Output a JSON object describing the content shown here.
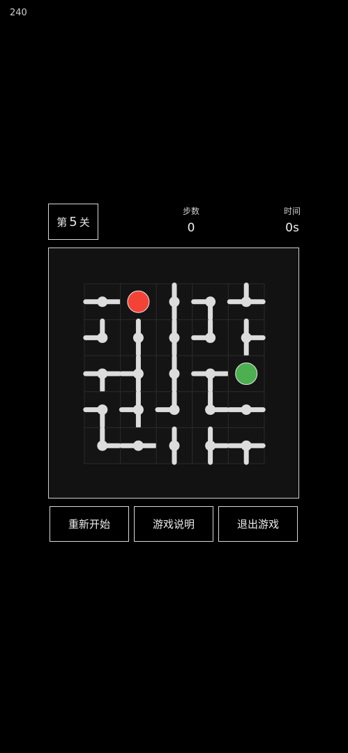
{
  "status": {
    "counter": "240"
  },
  "level": {
    "prefix": "第",
    "number": "5",
    "suffix": "关"
  },
  "stats": {
    "steps_label": "步数",
    "steps_value": "0",
    "time_label": "时间",
    "time_value": "0s"
  },
  "board": {
    "rows": 5,
    "cols": 5,
    "pipe_color": "#dcdcdc",
    "grid_color": "#2a2a2a",
    "cells": [
      [
        {
          "type": "pipe",
          "dirs": [
            "W",
            "E"
          ]
        },
        {
          "type": "start",
          "color": "#f44336"
        },
        {
          "type": "pipe",
          "dirs": [
            "N",
            "S"
          ]
        },
        {
          "type": "pipe",
          "dirs": [
            "W",
            "S"
          ]
        },
        {
          "type": "pipe",
          "dirs": [
            "N",
            "W",
            "E"
          ]
        }
      ],
      [
        {
          "type": "pipe",
          "dirs": [
            "N",
            "W"
          ]
        },
        {
          "type": "pipe",
          "dirs": [
            "N",
            "S"
          ]
        },
        {
          "type": "pipe",
          "dirs": [
            "N",
            "S"
          ]
        },
        {
          "type": "pipe",
          "dirs": [
            "N",
            "W"
          ]
        },
        {
          "type": "pipe",
          "dirs": [
            "N",
            "E",
            "S"
          ]
        }
      ],
      [
        {
          "type": "pipe",
          "dirs": [
            "W",
            "E",
            "S"
          ]
        },
        {
          "type": "pipe",
          "dirs": [
            "N",
            "W",
            "S"
          ]
        },
        {
          "type": "pipe",
          "dirs": [
            "N",
            "S"
          ]
        },
        {
          "type": "pipe",
          "dirs": [
            "W",
            "E",
            "S"
          ]
        },
        {
          "type": "end",
          "color": "#4caf50"
        }
      ],
      [
        {
          "type": "pipe",
          "dirs": [
            "W",
            "S"
          ]
        },
        {
          "type": "pipe",
          "dirs": [
            "N",
            "W",
            "S"
          ]
        },
        {
          "type": "pipe",
          "dirs": [
            "N",
            "W"
          ]
        },
        {
          "type": "pipe",
          "dirs": [
            "N",
            "E"
          ]
        },
        {
          "type": "pipe",
          "dirs": [
            "W",
            "E"
          ]
        }
      ],
      [
        {
          "type": "pipe",
          "dirs": [
            "N",
            "E"
          ]
        },
        {
          "type": "pipe",
          "dirs": [
            "W",
            "E"
          ]
        },
        {
          "type": "pipe",
          "dirs": [
            "N",
            "S"
          ]
        },
        {
          "type": "pipe",
          "dirs": [
            "N",
            "E",
            "S"
          ]
        },
        {
          "type": "pipe",
          "dirs": [
            "W",
            "E",
            "S"
          ]
        }
      ]
    ]
  },
  "buttons": {
    "restart": "重新开始",
    "help": "游戏说明",
    "quit": "退出游戏"
  }
}
